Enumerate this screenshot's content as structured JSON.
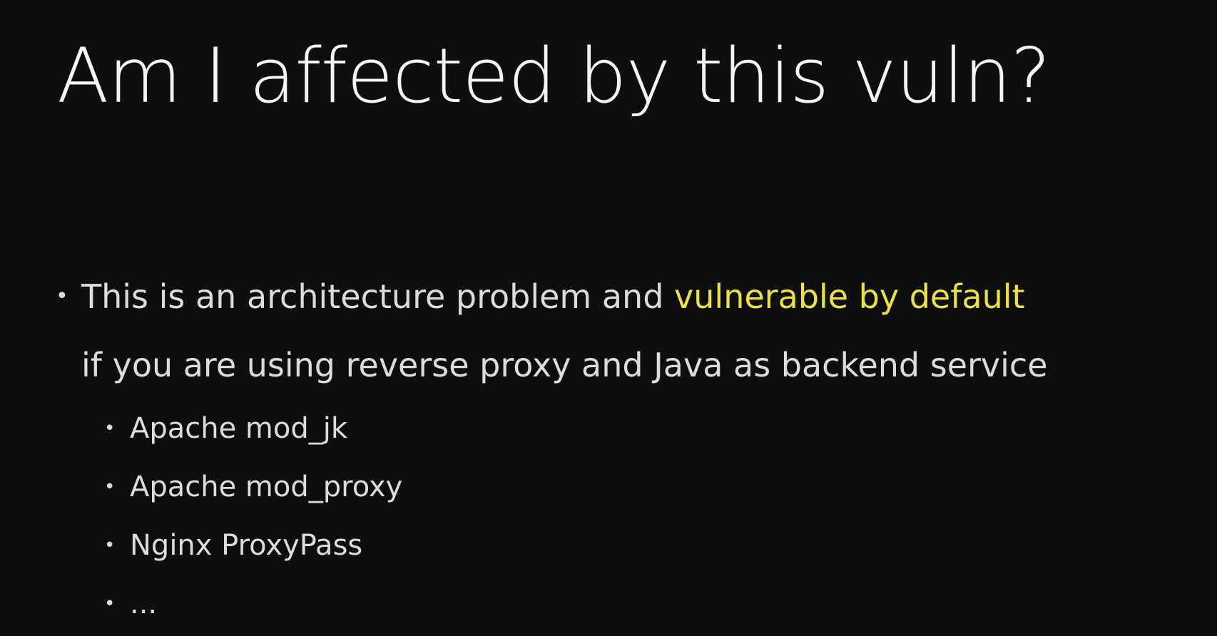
{
  "slide": {
    "title": "Am I affected by this vuln?",
    "bullet": {
      "text_before": "This is an architecture problem and ",
      "highlight": "vulnerable by default",
      "continuation": "if you are using reverse proxy and Java as backend service",
      "highlight_color": "#ebe13f"
    },
    "sub_bullets": [
      "Apache mod_jk",
      "Apache mod_proxy",
      "Nginx ProxyPass",
      "..."
    ],
    "bullet_glyph": "•"
  }
}
